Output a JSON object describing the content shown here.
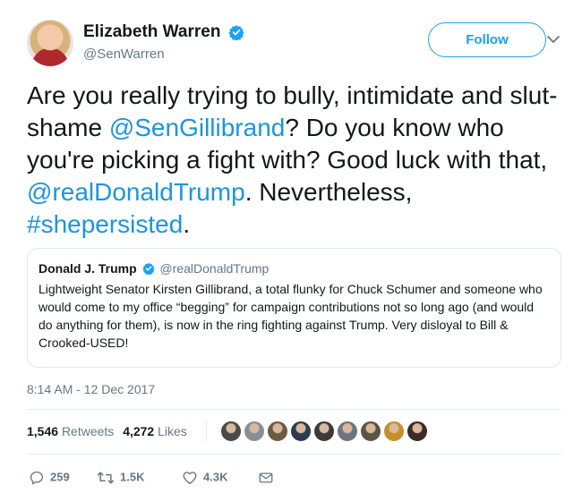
{
  "author": {
    "display_name": "Elizabeth Warren",
    "handle": "@SenWarren",
    "verified": true
  },
  "follow_label": "Follow",
  "tweet": {
    "segments": [
      {
        "text": "Are you really trying to bully, intimidate and slut-shame ",
        "link": false
      },
      {
        "text": "@SenGillibrand",
        "link": true
      },
      {
        "text": "? Do you know who you're picking a fight with? Good luck with that, ",
        "link": false
      },
      {
        "text": "@realDonaldTrump",
        "link": true
      },
      {
        "text": ". Nevertheless, ",
        "link": false
      },
      {
        "text": "#shepersisted",
        "link": true
      },
      {
        "text": ".",
        "link": false
      }
    ]
  },
  "quote": {
    "display_name": "Donald J. Trump",
    "handle": "@realDonaldTrump",
    "verified": true,
    "body": "Lightweight Senator Kirsten Gillibrand, a total flunky for Chuck Schumer and someone who would come to my office “begging” for campaign contributions not so long ago (and would do anything for them), is now in the ring fighting against Trump. Very disloyal to Bill & Crooked-USED!"
  },
  "timestamp": "8:14 AM - 12 Dec 2017",
  "stats": {
    "retweets_count": "1,546",
    "retweets_label": "Retweets",
    "likes_count": "4,272",
    "likes_label": "Likes"
  },
  "likers": [
    "#4a4a4a",
    "#8a8f96",
    "#6b5b45",
    "#2e3a4f",
    "#3a3a3a",
    "#6d7480",
    "#5b5346",
    "#c48f2b",
    "#3b2a2a"
  ],
  "actions": {
    "reply_count": "259",
    "retweet_count": "1.5K",
    "like_count": "4.3K"
  },
  "colors": {
    "link": "#1b95e0",
    "brand": "#1da1f2",
    "muted": "#657786"
  }
}
